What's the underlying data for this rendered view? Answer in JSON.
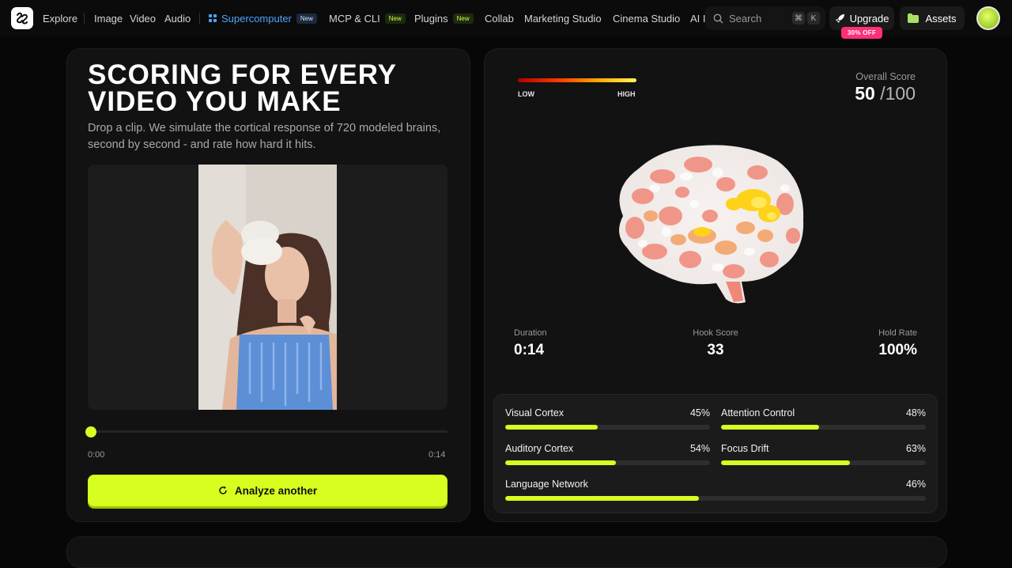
{
  "nav": {
    "explore": "Explore",
    "image": "Image",
    "video": "Video",
    "audio": "Audio",
    "supercomputer": "Supercomputer",
    "mcp": "MCP & CLI",
    "plugins": "Plugins",
    "new_badge": "New",
    "collab": "Collab",
    "marketing": "Marketing Studio",
    "cinema": "Cinema Studio",
    "ai_truncated": "AI I"
  },
  "search": {
    "placeholder": "Search",
    "key1": "⌘",
    "key2": "K"
  },
  "upgrade": {
    "label": "Upgrade",
    "discount": "30% OFF"
  },
  "assets": {
    "label": "Assets"
  },
  "hero": {
    "title_line1": "SCORING FOR EVERY",
    "title_line2": "VIDEO YOU MAKE",
    "subtitle": "Drop a clip. We simulate the cortical response of 720 modeled brains, second by second - and rate how hard it hits."
  },
  "player": {
    "current_time": "0:00",
    "total_time": "0:14",
    "progress": 0
  },
  "analyze": {
    "label": "Analyze another"
  },
  "legend": {
    "low": "LOW",
    "high": "HIGH"
  },
  "score": {
    "label": "Overall Score",
    "value": "50",
    "max": "/100"
  },
  "stats": {
    "duration_label": "Duration",
    "duration_value": "0:14",
    "hook_label": "Hook Score",
    "hook_value": "33",
    "hold_label": "Hold Rate",
    "hold_value": "100%"
  },
  "metrics": [
    {
      "name": "Visual Cortex",
      "value": "45%",
      "fraction": 0.45
    },
    {
      "name": "Attention Control",
      "value": "48%",
      "fraction": 0.48
    },
    {
      "name": "Auditory Cortex",
      "value": "54%",
      "fraction": 0.54
    },
    {
      "name": "Focus Drift",
      "value": "63%",
      "fraction": 0.63
    },
    {
      "name": "Language Network",
      "value": "46%",
      "fraction": 0.46
    }
  ],
  "colors": {
    "accent": "#d6ff1f",
    "badge_pink": "#ff2f7a",
    "supercomputer_blue": "#4da3ff"
  }
}
